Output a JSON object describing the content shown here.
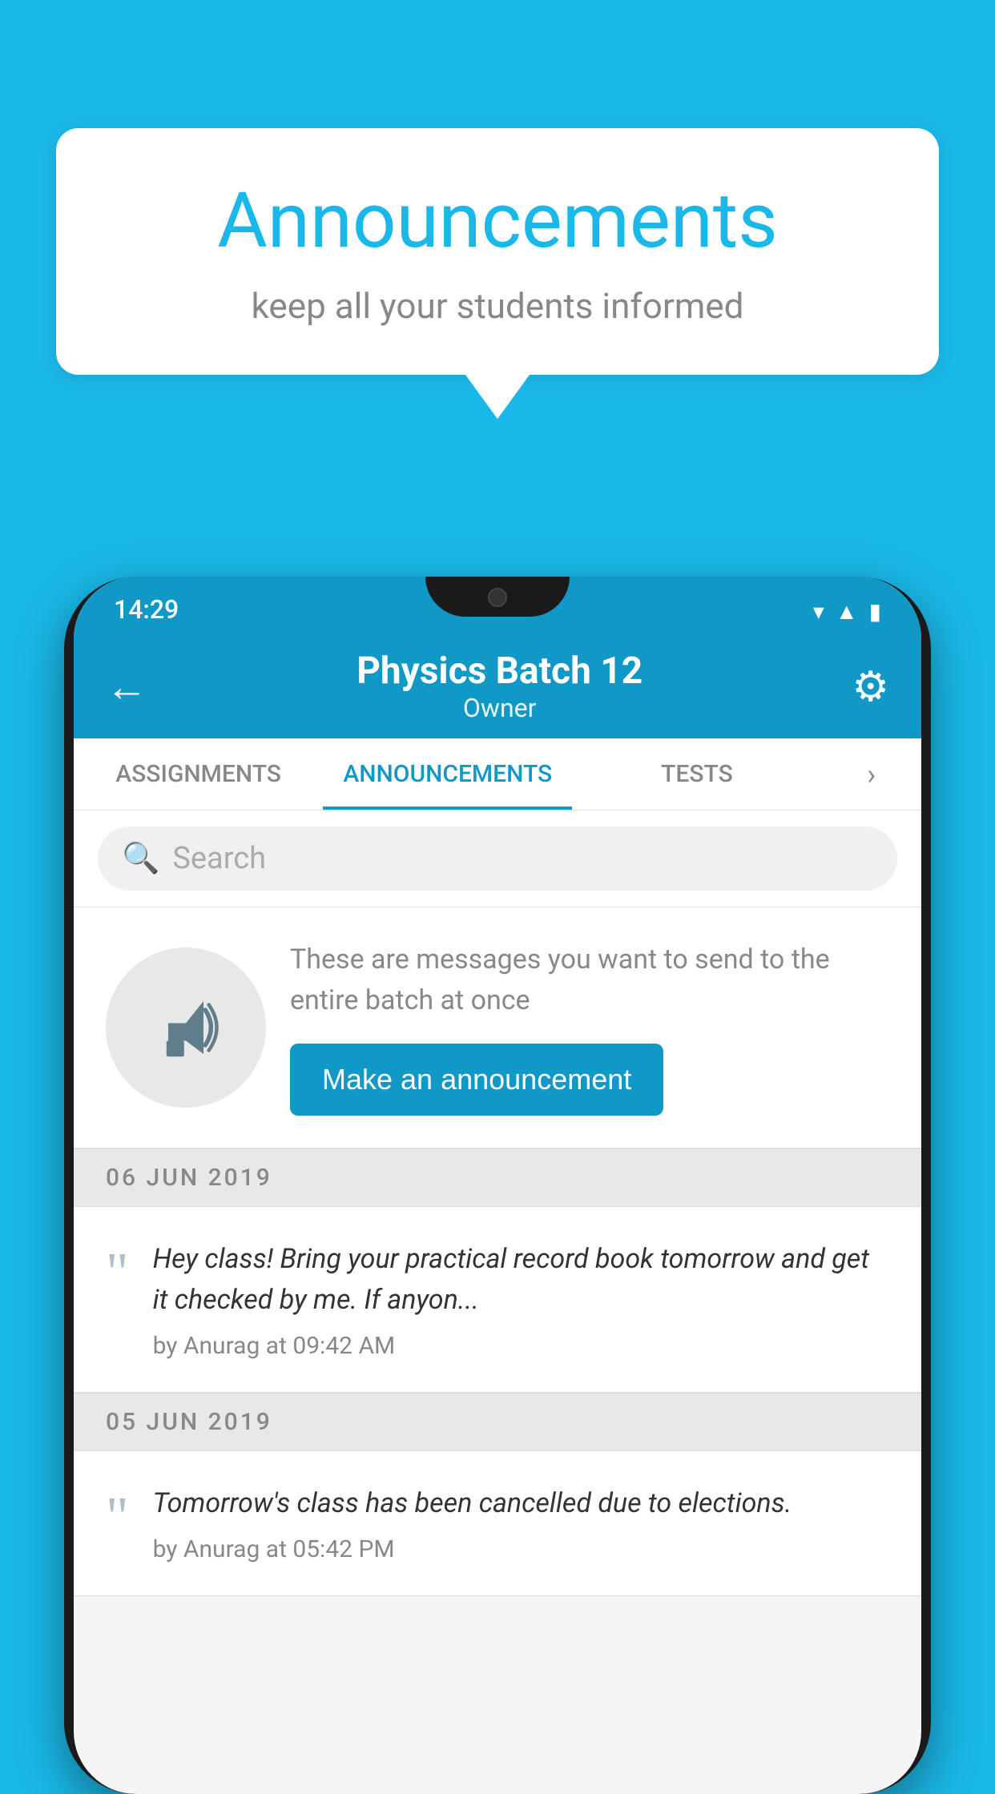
{
  "background_color": "#1ab8e8",
  "speech_bubble": {
    "title": "Announcements",
    "subtitle": "keep all your students informed"
  },
  "phone": {
    "status_bar": {
      "time": "14:29"
    },
    "app_bar": {
      "title": "Physics Batch 12",
      "subtitle": "Owner",
      "back_icon": "←",
      "gear_icon": "⚙"
    },
    "tabs": [
      {
        "label": "ASSIGNMENTS",
        "active": false
      },
      {
        "label": "ANNOUNCEMENTS",
        "active": true
      },
      {
        "label": "TESTS",
        "active": false
      }
    ],
    "search": {
      "placeholder": "Search"
    },
    "promo": {
      "description": "These are messages you want to send to the entire batch at once",
      "button_label": "Make an announcement"
    },
    "announcements": [
      {
        "date": "06  JUN  2019",
        "text": "Hey class! Bring your practical record book tomorrow and get it checked by me. If anyon...",
        "meta": "by Anurag at 09:42 AM"
      },
      {
        "date": "05  JUN  2019",
        "text": "Tomorrow's class has been cancelled due to elections.",
        "meta": "by Anurag at 05:42 PM"
      }
    ]
  }
}
